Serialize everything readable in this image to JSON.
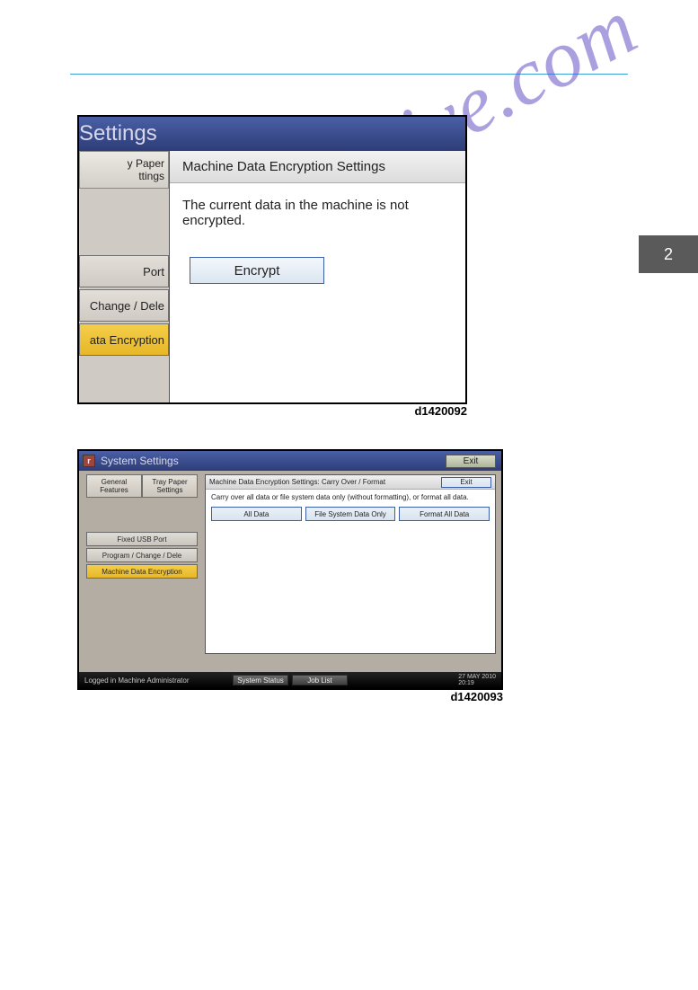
{
  "page": {
    "tab": "2"
  },
  "watermark": "manualshive.com",
  "fig1_id": "d1420092",
  "fig2_id": "d1420093",
  "shot1": {
    "titlebar": "Settings",
    "sidebar": {
      "tab1": "y Paper\nttings",
      "row1": "Port",
      "row2": "Change / Dele",
      "row3": "ata Encryption"
    },
    "dialog": {
      "heading": "Machine Data Encryption Settings",
      "message": "The current data in the machine is not encrypted.",
      "encrypt_btn": "Encrypt"
    }
  },
  "shot2": {
    "titlebar": "System Settings",
    "exit": "Exit",
    "left": {
      "tab1": "General\nFeatures",
      "tab2": "Tray Paper\nSettings",
      "row1": "Fixed USB Port",
      "row2": "Program / Change / Dele",
      "row3": "Machine Data Encryption"
    },
    "panel": {
      "title": "Machine Data Encryption Settings: Carry Over / Format",
      "exit": "Exit",
      "desc": "Carry over all data or file system data only (without formatting), or format all data.",
      "opt1": "All Data",
      "opt2": "File System Data Only",
      "opt3": "Format All Data"
    },
    "status": {
      "left": "Logged in  Machine Administrator",
      "btn1": "System Status",
      "btn2": "Job List",
      "date": "27 MAY  2010",
      "time": "20:19"
    }
  }
}
